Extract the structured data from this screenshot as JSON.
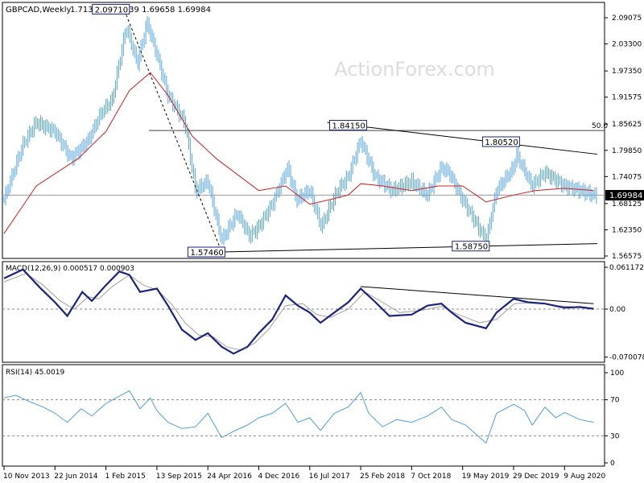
{
  "header": {
    "symbol": "GBPCAD,Weekly",
    "ohlc": "1.71302 1.71739 1.69658 1.69984"
  },
  "watermark": "ActionForex.com",
  "colors": {
    "price_bars": "#5aa6d8",
    "moving_average": "#cc2222",
    "macd_line": "#1a237e",
    "signal_line": "#a0a0a0",
    "rsi": "#4f9fd9",
    "trendline": "#000000",
    "watermark": "#dddddd"
  },
  "chart_data": [
    {
      "type": "candlestick",
      "panel": "price",
      "title": "GBPCAD,Weekly",
      "ylim": [
        1.55,
        2.12
      ],
      "y_ticks": [
        "2.09075",
        "2.03300",
        "1.97350",
        "1.91575",
        "1.85625",
        "1.79850",
        "1.74075",
        "1.68125",
        "1.62350",
        "1.56575"
      ],
      "last_price": "1.69984",
      "fib_level": {
        "label": "50.0",
        "value": 1.8422
      },
      "annotations": [
        {
          "label": "2.09710",
          "date": "2015-05-01",
          "value": 2.0971
        },
        {
          "label": "1.84150",
          "date": "2018-03-09",
          "value": 1.8415
        },
        {
          "label": "1.80520",
          "date": "2020-01-10",
          "value": 1.8052
        },
        {
          "label": "1.57460",
          "date": "2016-06-24",
          "value": 1.5746
        },
        {
          "label": "1.58750",
          "date": "2019-08-30",
          "value": 1.5875
        }
      ],
      "series_points": [
        [
          "2013-11-10",
          1.69
        ],
        [
          "2014-02-01",
          1.81
        ],
        [
          "2014-04-01",
          1.86
        ],
        [
          "2014-06-22",
          1.84
        ],
        [
          "2014-09-01",
          1.78
        ],
        [
          "2014-11-15",
          1.82
        ],
        [
          "2015-01-10",
          1.88
        ],
        [
          "2015-03-01",
          1.91
        ],
        [
          "2015-05-01",
          2.07
        ],
        [
          "2015-06-20",
          1.99
        ],
        [
          "2015-08-01",
          2.08
        ],
        [
          "2015-09-13",
          2.01
        ],
        [
          "2015-11-01",
          1.92
        ],
        [
          "2016-01-15",
          1.86
        ],
        [
          "2016-03-01",
          1.71
        ],
        [
          "2016-04-24",
          1.73
        ],
        [
          "2016-06-24",
          1.6
        ],
        [
          "2016-09-01",
          1.66
        ],
        [
          "2016-10-25",
          1.61
        ],
        [
          "2016-12-04",
          1.63
        ],
        [
          "2017-02-01",
          1.68
        ],
        [
          "2017-04-10",
          1.76
        ],
        [
          "2017-05-20",
          1.69
        ],
        [
          "2017-07-16",
          1.71
        ],
        [
          "2017-09-05",
          1.63
        ],
        [
          "2017-11-15",
          1.71
        ],
        [
          "2018-01-01",
          1.74
        ],
        [
          "2018-02-25",
          1.82
        ],
        [
          "2018-05-01",
          1.74
        ],
        [
          "2018-07-15",
          1.71
        ],
        [
          "2018-10-07",
          1.73
        ],
        [
          "2018-12-15",
          1.7
        ],
        [
          "2019-02-15",
          1.76
        ],
        [
          "2019-03-20",
          1.75
        ],
        [
          "2019-05-19",
          1.69
        ],
        [
          "2019-08-30",
          1.6
        ],
        [
          "2019-10-15",
          1.71
        ],
        [
          "2019-12-29",
          1.76
        ],
        [
          "2020-01-10",
          1.79
        ],
        [
          "2020-03-20",
          1.72
        ],
        [
          "2020-05-15",
          1.75
        ],
        [
          "2020-08-09",
          1.72
        ],
        [
          "2020-10-20",
          1.71
        ],
        [
          "2020-12-15",
          1.69984
        ]
      ],
      "ma_points": [
        [
          "2013-11-10",
          1.615
        ],
        [
          "2014-04-01",
          1.72
        ],
        [
          "2014-10-01",
          1.78
        ],
        [
          "2015-02-01",
          1.84
        ],
        [
          "2015-05-15",
          1.93
        ],
        [
          "2015-08-15",
          1.97
        ],
        [
          "2015-11-01",
          1.92
        ],
        [
          "2016-02-15",
          1.83
        ],
        [
          "2016-06-01",
          1.78
        ],
        [
          "2016-09-15",
          1.74
        ],
        [
          "2016-12-04",
          1.71
        ],
        [
          "2017-04-01",
          1.72
        ],
        [
          "2017-07-16",
          1.68
        ],
        [
          "2017-10-15",
          1.69
        ],
        [
          "2018-01-01",
          1.7
        ],
        [
          "2018-02-25",
          1.725
        ],
        [
          "2018-06-01",
          1.72
        ],
        [
          "2018-10-07",
          1.71
        ],
        [
          "2019-02-01",
          1.72
        ],
        [
          "2019-05-19",
          1.72
        ],
        [
          "2019-08-30",
          1.685
        ],
        [
          "2019-12-29",
          1.7
        ],
        [
          "2020-04-01",
          1.71
        ],
        [
          "2020-08-09",
          1.715
        ],
        [
          "2020-12-15",
          1.71
        ]
      ],
      "trendlines": [
        {
          "from": [
            "2015-05-01",
            2.0971
          ],
          "to": [
            "2016-06-24",
            1.5746
          ],
          "style": "dashed"
        },
        {
          "from": [
            "2016-06-24",
            1.5746
          ],
          "to": [
            "2020-12-31",
            1.593
          ],
          "style": "solid"
        },
        {
          "from": [
            "2017-10-01",
            1.86
          ],
          "to": [
            "2020-12-31",
            1.79
          ],
          "style": "solid"
        }
      ]
    },
    {
      "type": "line",
      "panel": "macd",
      "title": "MACD(12,26,9) 0.000517 0.000903",
      "ylim": [
        -0.07578,
        0.066
      ],
      "y_ticks": [
        "0.061172",
        "0.00",
        "-0.070078"
      ],
      "macd_points": [
        [
          "2013-11-10",
          0.045
        ],
        [
          "2014-02-01",
          0.058
        ],
        [
          "2014-04-15",
          0.032
        ],
        [
          "2014-06-22",
          0.01
        ],
        [
          "2014-08-15",
          -0.01
        ],
        [
          "2014-10-20",
          0.025
        ],
        [
          "2014-12-01",
          0.012
        ],
        [
          "2015-02-01",
          0.035
        ],
        [
          "2015-04-01",
          0.055
        ],
        [
          "2015-05-15",
          0.05
        ],
        [
          "2015-07-01",
          0.025
        ],
        [
          "2015-09-13",
          0.03
        ],
        [
          "2015-11-01",
          0.005
        ],
        [
          "2016-01-01",
          -0.03
        ],
        [
          "2016-03-01",
          -0.045
        ],
        [
          "2016-04-24",
          -0.035
        ],
        [
          "2016-06-24",
          -0.055
        ],
        [
          "2016-08-15",
          -0.065
        ],
        [
          "2016-10-15",
          -0.055
        ],
        [
          "2016-12-04",
          -0.035
        ],
        [
          "2017-02-01",
          -0.015
        ],
        [
          "2017-04-01",
          0.02
        ],
        [
          "2017-05-25",
          0.005
        ],
        [
          "2017-07-16",
          -0.005
        ],
        [
          "2017-09-01",
          -0.02
        ],
        [
          "2017-11-01",
          -0.005
        ],
        [
          "2018-01-01",
          0.01
        ],
        [
          "2018-02-25",
          0.03
        ],
        [
          "2018-05-01",
          0.01
        ],
        [
          "2018-07-01",
          -0.01
        ],
        [
          "2018-10-07",
          -0.008
        ],
        [
          "2018-12-15",
          0.005
        ],
        [
          "2019-02-15",
          0.008
        ],
        [
          "2019-04-01",
          -0.005
        ],
        [
          "2019-06-01",
          -0.02
        ],
        [
          "2019-08-30",
          -0.028
        ],
        [
          "2019-10-15",
          -0.005
        ],
        [
          "2019-12-29",
          0.015
        ],
        [
          "2020-03-01",
          0.01
        ],
        [
          "2020-05-15",
          0.008
        ],
        [
          "2020-08-09",
          0.002
        ],
        [
          "2020-10-15",
          0.003
        ],
        [
          "2020-12-15",
          0.000517
        ]
      ],
      "signal_points": [
        [
          "2013-11-10",
          0.04
        ],
        [
          "2014-02-15",
          0.052
        ],
        [
          "2014-05-01",
          0.035
        ],
        [
          "2014-07-15",
          0.012
        ],
        [
          "2014-09-15",
          0.0
        ],
        [
          "2014-11-15",
          0.018
        ],
        [
          "2015-01-01",
          0.015
        ],
        [
          "2015-03-01",
          0.033
        ],
        [
          "2015-05-15",
          0.05
        ],
        [
          "2015-07-15",
          0.035
        ],
        [
          "2015-09-15",
          0.028
        ],
        [
          "2015-11-15",
          0.008
        ],
        [
          "2016-01-15",
          -0.02
        ],
        [
          "2016-03-15",
          -0.038
        ],
        [
          "2016-05-15",
          -0.04
        ],
        [
          "2016-07-15",
          -0.055
        ],
        [
          "2016-09-15",
          -0.06
        ],
        [
          "2016-11-15",
          -0.05
        ],
        [
          "2017-01-15",
          -0.03
        ],
        [
          "2017-04-01",
          0.005
        ],
        [
          "2017-06-15",
          0.008
        ],
        [
          "2017-08-15",
          -0.008
        ],
        [
          "2017-10-15",
          -0.012
        ],
        [
          "2018-01-01",
          0.0
        ],
        [
          "2018-03-15",
          0.025
        ],
        [
          "2018-06-01",
          0.01
        ],
        [
          "2018-08-15",
          -0.005
        ],
        [
          "2018-11-15",
          -0.002
        ],
        [
          "2019-02-15",
          0.004
        ],
        [
          "2019-05-01",
          -0.008
        ],
        [
          "2019-08-01",
          -0.02
        ],
        [
          "2019-10-15",
          -0.015
        ],
        [
          "2020-01-01",
          0.008
        ],
        [
          "2020-04-01",
          0.01
        ],
        [
          "2020-07-01",
          0.005
        ],
        [
          "2020-10-01",
          0.003
        ],
        [
          "2020-12-15",
          0.000903
        ]
      ],
      "trendline": {
        "from": [
          "2018-02-25",
          0.033
        ],
        "to": [
          "2020-12-15",
          0.008
        ]
      }
    },
    {
      "type": "line",
      "panel": "rsi",
      "title": "RSI(14) 45.0019",
      "ylim": [
        0,
        100
      ],
      "y_ticks": [
        "100",
        "70",
        "30",
        "0"
      ],
      "levels": [
        70,
        30
      ],
      "rsi_points": [
        [
          "2013-11-10",
          72
        ],
        [
          "2014-01-01",
          75
        ],
        [
          "2014-03-01",
          68
        ],
        [
          "2014-05-01",
          62
        ],
        [
          "2014-06-22",
          55
        ],
        [
          "2014-08-15",
          45
        ],
        [
          "2014-10-15",
          60
        ],
        [
          "2014-12-01",
          52
        ],
        [
          "2015-02-01",
          66
        ],
        [
          "2015-04-01",
          74
        ],
        [
          "2015-05-15",
          80
        ],
        [
          "2015-07-01",
          60
        ],
        [
          "2015-08-15",
          72
        ],
        [
          "2015-09-13",
          58
        ],
        [
          "2015-11-01",
          45
        ],
        [
          "2016-01-01",
          38
        ],
        [
          "2016-03-01",
          40
        ],
        [
          "2016-04-24",
          55
        ],
        [
          "2016-06-24",
          28
        ],
        [
          "2016-08-15",
          35
        ],
        [
          "2016-10-15",
          42
        ],
        [
          "2016-12-04",
          50
        ],
        [
          "2017-02-01",
          55
        ],
        [
          "2017-04-01",
          66
        ],
        [
          "2017-05-25",
          45
        ],
        [
          "2017-07-16",
          50
        ],
        [
          "2017-09-01",
          36
        ],
        [
          "2017-11-01",
          55
        ],
        [
          "2018-01-01",
          62
        ],
        [
          "2018-02-25",
          78
        ],
        [
          "2018-04-01",
          55
        ],
        [
          "2018-06-01",
          40
        ],
        [
          "2018-08-01",
          48
        ],
        [
          "2018-10-07",
          45
        ],
        [
          "2018-12-15",
          52
        ],
        [
          "2019-02-15",
          62
        ],
        [
          "2019-04-01",
          48
        ],
        [
          "2019-06-01",
          42
        ],
        [
          "2019-08-30",
          22
        ],
        [
          "2019-10-15",
          55
        ],
        [
          "2019-12-29",
          65
        ],
        [
          "2020-02-15",
          58
        ],
        [
          "2020-03-20",
          42
        ],
        [
          "2020-05-15",
          62
        ],
        [
          "2020-07-01",
          50
        ],
        [
          "2020-08-09",
          56
        ],
        [
          "2020-10-15",
          48
        ],
        [
          "2020-12-15",
          45.0019
        ]
      ]
    }
  ],
  "x_axis": {
    "ticks": [
      {
        "label": "10 Nov 2013",
        "date": "2013-11-10"
      },
      {
        "label": "22 Jun 2014",
        "date": "2014-06-22"
      },
      {
        "label": "1 Feb 2015",
        "date": "2015-02-01"
      },
      {
        "label": "13 Sep 2015",
        "date": "2015-09-13"
      },
      {
        "label": "24 Apr 2016",
        "date": "2016-04-24"
      },
      {
        "label": "4 Dec 2016",
        "date": "2016-12-04"
      },
      {
        "label": "16 Jul 2017",
        "date": "2017-07-16"
      },
      {
        "label": "25 Feb 2018",
        "date": "2018-02-25"
      },
      {
        "label": "7 Oct 2018",
        "date": "2018-10-07"
      },
      {
        "label": "19 May 2019",
        "date": "2019-05-19"
      },
      {
        "label": "29 Dec 2019",
        "date": "2019-12-29"
      },
      {
        "label": "9 Aug 2020",
        "date": "2020-08-09"
      }
    ]
  }
}
